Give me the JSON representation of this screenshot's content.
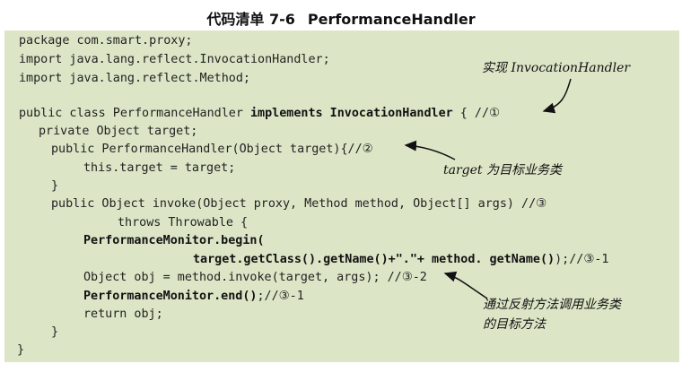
{
  "caption": {
    "label": "代码清单 7-6",
    "title": "PerformanceHandler"
  },
  "code": {
    "l1": "package com.smart.proxy;",
    "l2": "import java.lang.reflect.InvocationHandler;",
    "l3": "import java.lang.reflect.Method;",
    "l5a": "public class PerformanceHandler ",
    "l5b": "implements InvocationHandler",
    "l5c": " { //①",
    "l6": "private Object target;",
    "l7": "public PerformanceHandler(Object target){//②",
    "l8": "this.target = target;",
    "l9": "}",
    "l10": "public Object invoke(Object proxy, Method method, Object[] args) //③",
    "l11": "throws Throwable {",
    "l12": "PerformanceMonitor.begin(",
    "l13a": "target.getClass().getName()+\".\"+ method. getName()",
    "l13b": ");//③-1",
    "l14": "Object obj = method.invoke(target, args); //③-2",
    "l15a": "PerformanceMonitor.end()",
    "l15b": ";//③-1",
    "l16": "return obj;",
    "l17": "}",
    "l18": "}"
  },
  "annotations": {
    "implement": "实现 InvocationHandler",
    "target": "target 为目标业务类",
    "reflect_1": "通过反射方法调用业务类",
    "reflect_2": "的目标方法"
  }
}
